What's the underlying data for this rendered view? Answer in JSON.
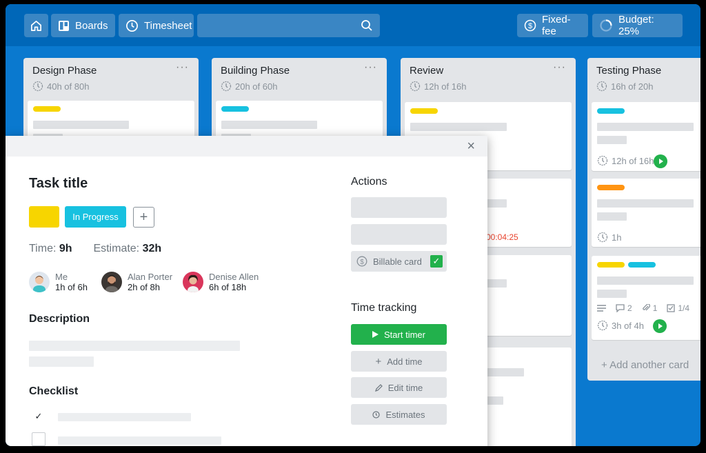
{
  "topbar": {
    "boards_label": "Boards",
    "timesheet_label": "Timesheet",
    "fixed_fee_label": "Fixed-fee",
    "budget_label": "Budget: 25%",
    "budget_progress": 0.25
  },
  "lists": [
    {
      "title": "Design Phase",
      "hours": "40h of 80h"
    },
    {
      "title": "Building Phase",
      "hours": "20h of 60h"
    },
    {
      "title": "Review",
      "hours": "12h of 16h",
      "running_timer": "00:04:25"
    },
    {
      "title": "Testing Phase",
      "hours": "16h of 20h",
      "cards": [
        {
          "time": "12h of 16h"
        },
        {
          "time": "1h"
        },
        {
          "time": "3h of 4h",
          "comments": "2",
          "attachments": "1",
          "checklist": "1/4"
        }
      ],
      "add_card_label": "+ Add another card"
    }
  ],
  "modal": {
    "close_label": "×",
    "task_title": "Task title",
    "status_label": "In Progress",
    "time_label": "Time:",
    "time_value": "9h",
    "estimate_label": "Estimate:",
    "estimate_value": "32h",
    "people": [
      {
        "name": "Me",
        "hours": "1h of 6h"
      },
      {
        "name": "Alan Porter",
        "hours": "2h of 8h"
      },
      {
        "name": "Denise Allen",
        "hours": "6h of 18h"
      }
    ],
    "description_title": "Description",
    "checklist_title": "Checklist",
    "actions_title": "Actions",
    "billable_label": "Billable card",
    "time_tracking_title": "Time tracking",
    "start_timer_label": "Start timer",
    "add_time_label": "Add time",
    "edit_time_label": "Edit time",
    "estimates_label": "Estimates"
  },
  "colors": {
    "board_bg": "#0a79cf",
    "topbar_bg": "#0067b8",
    "tag_yellow": "#f7d500",
    "tag_cyan": "#17c1e0",
    "tag_orange": "#ff9412",
    "green": "#22b14c",
    "timer_red": "#e8432d"
  }
}
